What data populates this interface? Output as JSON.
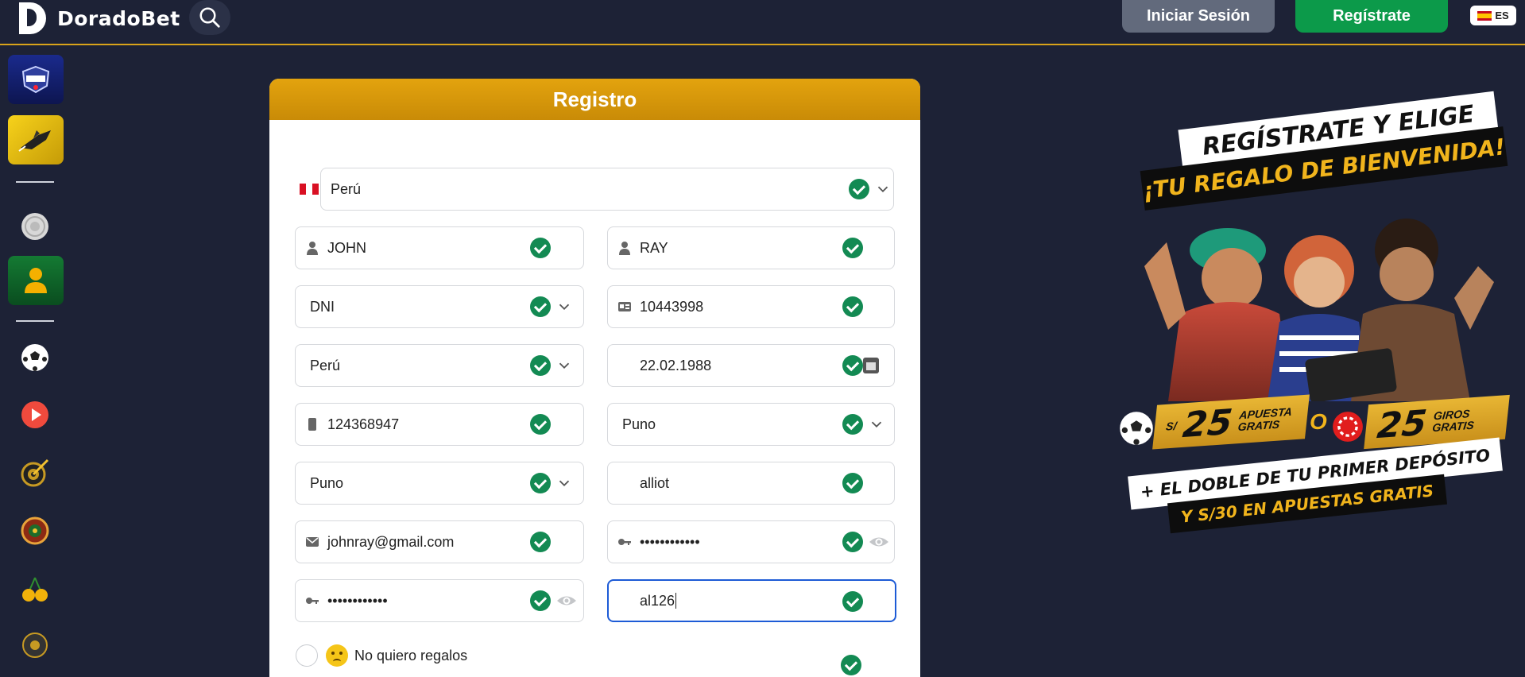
{
  "header": {
    "brand": "DoradoBet",
    "login_label": "Iniciar Sesión",
    "register_label": "Regístrate",
    "language": "ES"
  },
  "sidebar": {
    "items": [
      {
        "icon": "football-game-icon",
        "active": false
      },
      {
        "icon": "aviator-icon",
        "active": true
      },
      {
        "icon": "coin-icon"
      },
      {
        "icon": "user-icon",
        "active": true
      },
      {
        "icon": "soccer-ball-icon"
      },
      {
        "icon": "play-icon"
      },
      {
        "icon": "dart-icon"
      },
      {
        "icon": "roulette-icon"
      },
      {
        "icon": "cherries-icon"
      },
      {
        "icon": "ball-icon"
      }
    ]
  },
  "form": {
    "title": "Registro",
    "country": "Perú",
    "first_name": "JOHN",
    "last_name": "RAY",
    "doc_type": "DNI",
    "doc_number": "10443998",
    "nationality": "Perú",
    "birth_date": "22.02.1988",
    "phone": "124368947",
    "department": "Puno",
    "city": "Puno",
    "username": "alliot",
    "email": "johnray@gmail.com",
    "password": "••••••••••••",
    "password_confirm": "••••••••••••",
    "promo_code": "al126",
    "no_gift_label": "No quiero regalos"
  },
  "promo": {
    "title_line1": "REGÍSTRATE Y ELIGE",
    "title_line2": "¡TU REGALO DE BIENVENIDA!",
    "offer1_currency": "S/",
    "offer1_amount": "25",
    "offer1_text_1": "APUESTA",
    "offer1_text_2": "GRATIS",
    "or_label": "O",
    "offer2_amount": "25",
    "offer2_text_1": "GIROS",
    "offer2_text_2": "GRATIS",
    "extra_line1": "+ EL DOBLE DE TU PRIMER DEPÓSITO",
    "extra_line2": "Y S/30 EN APUESTAS GRATIS"
  },
  "colors": {
    "background": "#1d2236",
    "accent_gold": "#d9a31a",
    "register_green": "#0c9a4a",
    "check_green": "#138a53",
    "focus_blue": "#1d5bd6"
  }
}
